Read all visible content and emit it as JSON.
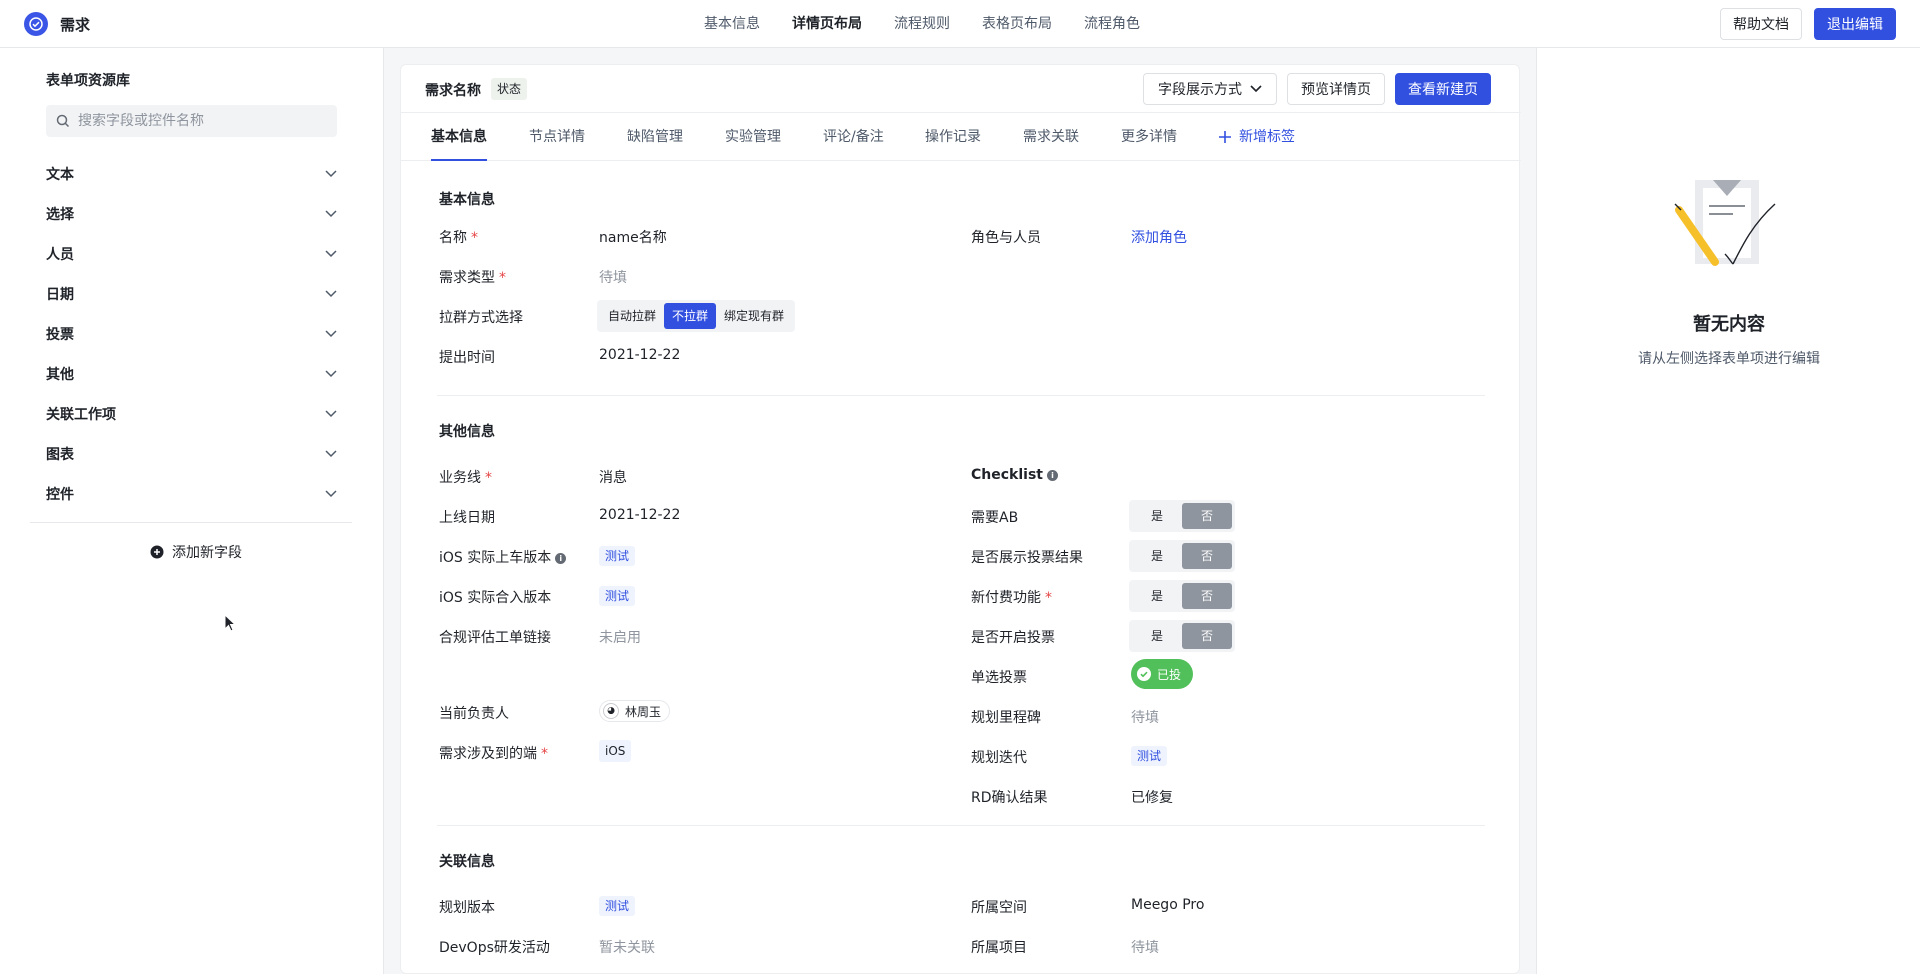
{
  "app": {
    "title": "需求"
  },
  "nav": {
    "items": [
      "基本信息",
      "详情页布局",
      "流程规则",
      "表格页布局",
      "流程角色"
    ],
    "active_index": 1
  },
  "header_actions": {
    "help": "帮助文档",
    "exit": "退出编辑"
  },
  "left": {
    "title": "表单项资源库",
    "search_placeholder": "搜索字段或控件名称",
    "categories": [
      "文本",
      "选择",
      "人员",
      "日期",
      "投票",
      "其他",
      "关联工作项",
      "图表",
      "控件"
    ],
    "add_field": "添加新字段"
  },
  "center": {
    "req_name": "需求名称",
    "status": "状态",
    "field_mode": "字段展示方式",
    "preview": "预览详情页",
    "view_new": "查看新建页",
    "tabs": [
      "基本信息",
      "节点详情",
      "缺陷管理",
      "实验管理",
      "评论/备注",
      "操作记录",
      "需求关联",
      "更多详情"
    ],
    "tab_add": "新增标签",
    "basic": {
      "title": "基本信息",
      "name_label": "名称",
      "name_value": "name名称",
      "type_label": "需求类型",
      "type_value": "待填",
      "group_label": "拉群方式选择",
      "group_options": [
        "自动拉群",
        "不拉群",
        "绑定现有群"
      ],
      "time_label": "提出时间",
      "time_value": "2021-12-22",
      "roles_label": "角色与人员",
      "roles_value": "添加角色"
    },
    "other": {
      "title": "其他信息",
      "biz_label": "业务线",
      "biz_value": "消息",
      "online_label": "上线日期",
      "online_value": "2021-12-22",
      "ios_ver_label": "iOS 实际上车版本",
      "ios_ver_value": "测试",
      "ios_merge_label": "iOS 实际合入版本",
      "ios_merge_value": "测试",
      "compliance_label": "合规评估工单链接",
      "compliance_value": "未启用",
      "owner_label": "当前负责人",
      "owner_value": "林周玉",
      "platform_label": "需求涉及到的端",
      "platform_value": "iOS",
      "checklist_label": "Checklist",
      "ab_label": "需要AB",
      "vote_result_label": "是否展示投票结果",
      "paid_label": "新付费功能",
      "open_vote_label": "是否开启投票",
      "yes": "是",
      "no": "否",
      "single_vote_label": "单选投票",
      "single_vote_value": "已投",
      "milestone_label": "规划里程碑",
      "milestone_value": "待填",
      "iteration_label": "规划迭代",
      "iteration_value": "测试",
      "rd_label": "RD确认结果",
      "rd_value": "已修复"
    },
    "related": {
      "title": "关联信息",
      "plan_ver_label": "规划版本",
      "plan_ver_value": "测试",
      "devops_label": "DevOps研发活动",
      "devops_value": "暂未关联",
      "space_label": "所属空间",
      "space_value": "Meego Pro",
      "project_label": "所属项目",
      "project_value": "待填"
    }
  },
  "right": {
    "empty_title": "暂无内容",
    "empty_sub": "请从左侧选择表单项进行编辑"
  },
  "colors": {
    "primary": "#3250e0",
    "vote_green": "#52c05a",
    "required": "#e54545"
  }
}
